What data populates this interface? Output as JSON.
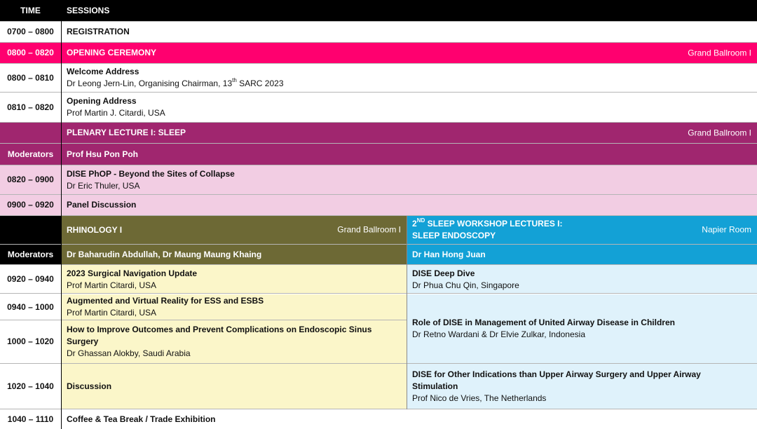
{
  "header": {
    "time": "TIME",
    "sessions": "SESSIONS"
  },
  "registration": {
    "time": "0700 – 0800",
    "title": "REGISTRATION"
  },
  "opening": {
    "time": "0800 – 0820",
    "title": "OPENING CEREMONY",
    "venue": "Grand Ballroom I"
  },
  "welcome": {
    "time": "0800 – 0810",
    "title": "Welcome Address",
    "speaker_pre": "Dr Leong Jern-Lin, Organising Chairman, 13",
    "speaker_sup": "th",
    "speaker_post": " SARC 2023"
  },
  "opening_address": {
    "time": "0810 – 0820",
    "title": "Opening Address",
    "speaker": "Prof Martin J. Citardi, USA"
  },
  "plenary": {
    "title": "PLENARY LECTURE I: SLEEP",
    "venue": "Grand Ballroom I",
    "moderators_label": "Moderators",
    "moderators": "Prof Hsu Pon Poh"
  },
  "dise_phop": {
    "time": "0820 – 0900",
    "title": "DISE PhOP - Beyond the Sites of Collapse",
    "speaker": "Dr Eric Thuler, USA"
  },
  "panel": {
    "time": "0900 – 0920",
    "title": "Panel Discussion"
  },
  "rhinology": {
    "title": "RHINOLOGY I",
    "venue": "Grand Ballroom I",
    "moderators_label": "Moderators",
    "moderators": "Dr Baharudin Abdullah, Dr Maung Maung Khaing"
  },
  "sleep_ws": {
    "title_num": "2",
    "title_sup": "ND",
    "title_rest": " SLEEP WORKSHOP LECTURES I:",
    "title_line2": "SLEEP ENDOSCOPY",
    "venue": "Napier Room",
    "moderators": "Dr Han Hong Juan"
  },
  "rows": {
    "r1": {
      "time": "0920 – 0940",
      "left_title": "2023 Surgical Navigation Update",
      "left_speaker": "Prof Martin Citardi, USA",
      "right_title": "DISE Deep Dive",
      "right_speaker": "Dr Phua Chu Qin, Singapore"
    },
    "r2": {
      "time": "0940 – 1000",
      "left_title": "Augmented and Virtual Reality for ESS and ESBS",
      "left_speaker": "Prof Martin Citardi, USA"
    },
    "r3": {
      "time": "1000 – 1020",
      "left_title_1": "How to Improve Outcomes and Prevent Complications on Endoscopic Sinus",
      "left_title_2": "Surgery",
      "left_speaker": "Dr Ghassan Alokby, Saudi Arabia"
    },
    "r23_right": {
      "title": "Role of DISE in Management of United Airway Disease in Children",
      "speaker": "Dr Retno Wardani & Dr Elvie Zulkar, Indonesia"
    },
    "r4": {
      "time": "1020 – 1040",
      "left_title": "Discussion",
      "right_title_1": "DISE for Other Indications than Upper Airway Surgery and Upper Airway",
      "right_title_2": "Stimulation",
      "right_speaker": "Prof Nico de Vries, The Netherlands"
    }
  },
  "break": {
    "time": "1040 – 1110",
    "title": "Coffee & Tea Break / Trade Exhibition"
  },
  "colors": {
    "header_bg": "#000000",
    "opening_bg": "#ff006f",
    "plenary_bg": "#a0266f",
    "plenary_light": "#f2cde3",
    "rhino_bg": "#6d6935",
    "rhino_light": "#fbf6c9",
    "sleep_bg": "#13a1d6",
    "sleep_light": "#dff2fb"
  }
}
